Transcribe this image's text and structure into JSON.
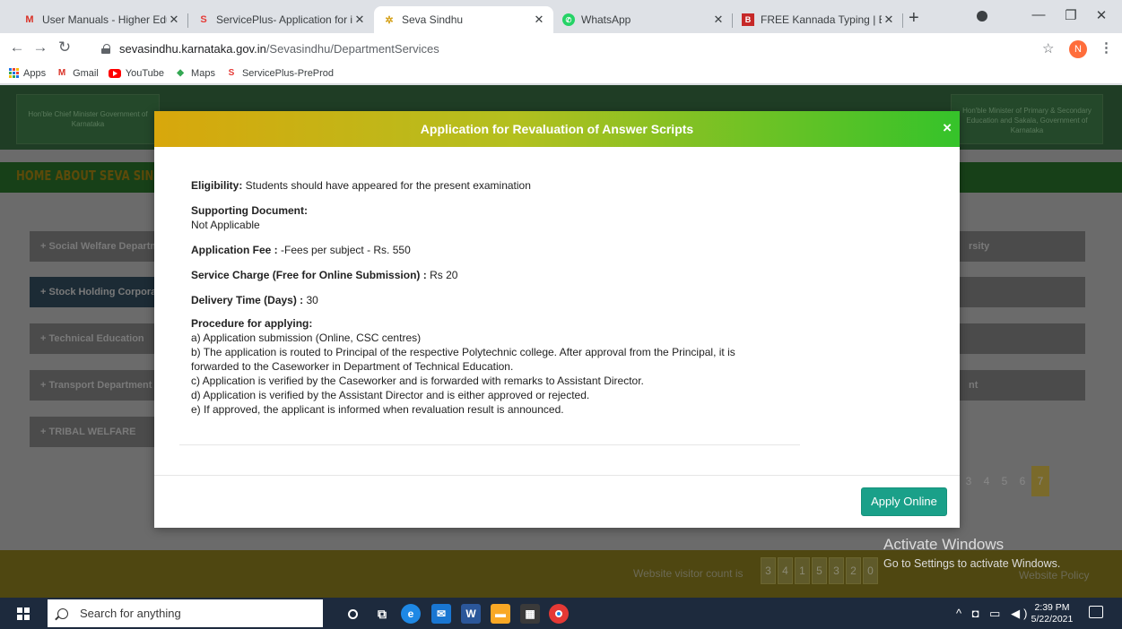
{
  "browser": {
    "tabs": [
      {
        "title": "User Manuals - Higher Educa",
        "icon": "gmail-icon"
      },
      {
        "title": "ServicePlus- Application for is",
        "icon": "serviceplus-icon"
      },
      {
        "title": "Seva Sindhu",
        "icon": "seva-sindhu-icon",
        "active": true
      },
      {
        "title": "WhatsApp",
        "icon": "whatsapp-icon"
      },
      {
        "title": "FREE Kannada Typing | Englis",
        "icon": "kannada-typing-icon"
      }
    ],
    "url_host": "sevasindhu.karnataka.gov.in",
    "url_path": "/Sevasindhu/DepartmentServices",
    "profile_initial": "N",
    "bookmarks": [
      "Apps",
      "Gmail",
      "YouTube",
      "Maps",
      "ServicePlus-PreProd"
    ]
  },
  "page": {
    "banner_left": "Hon'ble Chief Minister\nGovernment of Karnataka",
    "banner_right": "Hon'ble Minister of Primary & Secondary Education and Sakala, Government of Karnataka",
    "nav": "HOME  ABOUT SEVA SINDHU",
    "departments": [
      "+ Social Welfare Department",
      "+ Stock Holding Corporation",
      "+ Technical Education",
      "+ Transport Department",
      "+ TRIBAL WELFARE"
    ],
    "right_items": [
      "rsity",
      "",
      "",
      "nt",
      ""
    ],
    "pager": [
      "3",
      "4",
      "5",
      "6",
      "7"
    ],
    "visitor_label": "Website visitor count is",
    "visitor_digits": [
      "3",
      "4",
      "1",
      "5",
      "3",
      "2",
      "0"
    ],
    "policy": "Website Policy"
  },
  "modal": {
    "title": "Application for Revaluation of Answer Scripts",
    "close": "×",
    "eligibility_label": "Eligibility:",
    "eligibility_value": " Students should have appeared for the present examination",
    "supporting_label": "Supporting Document:",
    "supporting_value": "Not Applicable",
    "fee_label": "Application Fee :",
    "fee_value": " -Fees per subject - Rs. 550",
    "service_label": "Service Charge (Free for Online Submission) :",
    "service_value": " Rs 20",
    "delivery_label": "Delivery Time (Days) :",
    "delivery_value": " 30",
    "procedure_label": "Procedure for applying:",
    "procedure_lines": [
      "a) Application submission (Online, CSC centres)",
      "b) The application is routed to Principal of the respective Polytechnic college. After approval from the Principal, it is",
      "forwarded to the Caseworker in Department of Technical Education.",
      "c) Application is verified by the Caseworker and is forwarded with remarks to Assistant Director.",
      "d) Application is verified by the Assistant Director and is either approved or rejected.",
      "e) If approved, the applicant is informed when revaluation result is announced."
    ],
    "apply_button": "Apply Online"
  },
  "windows": {
    "activate_title": "Activate Windows",
    "activate_sub": "Go to Settings to activate Windows.",
    "search_placeholder": "Search for anything",
    "time": "2:39 PM",
    "date": "5/22/2021"
  }
}
